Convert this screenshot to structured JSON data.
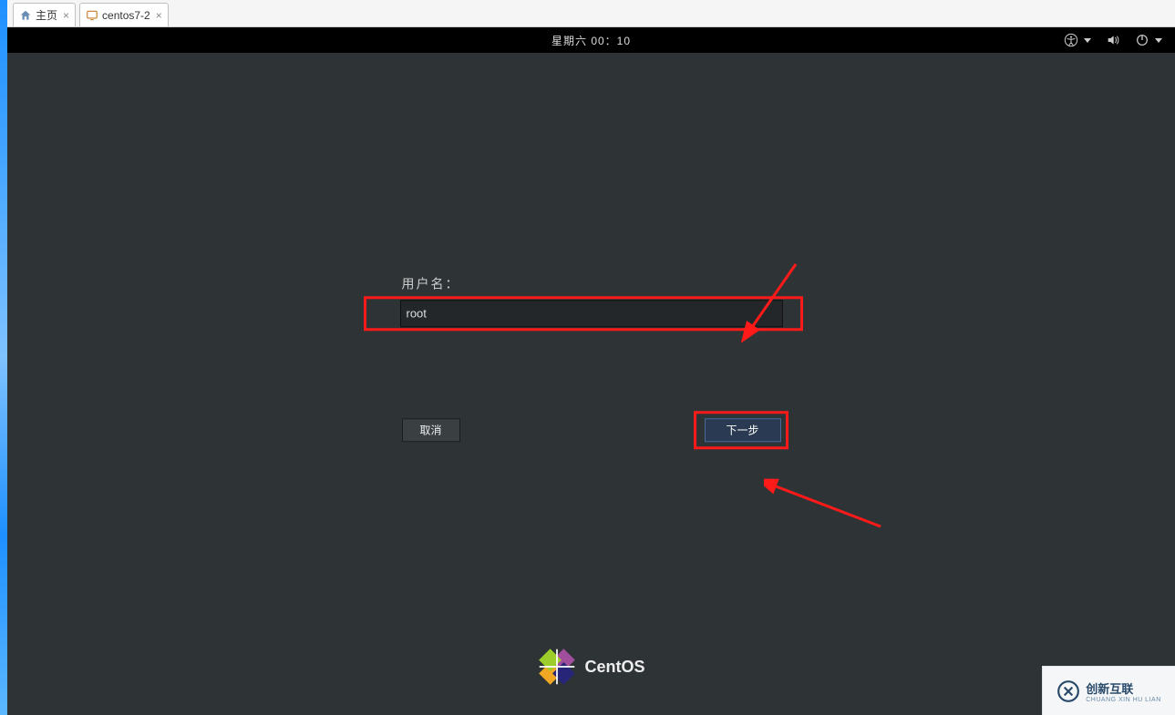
{
  "tabs": [
    {
      "label": "主页",
      "icon": "home-icon"
    },
    {
      "label": "centos7-2",
      "icon": "vm-icon"
    }
  ],
  "topbar": {
    "datetime": "星期六 00：10"
  },
  "login": {
    "username_label": "用户名：",
    "username_value": "root",
    "cancel_label": "取消",
    "next_label": "下一步"
  },
  "branding": {
    "distro": "CentOS"
  },
  "watermark": {
    "text": "创新互联",
    "sub": "CHUANG XIN HU LIAN"
  }
}
